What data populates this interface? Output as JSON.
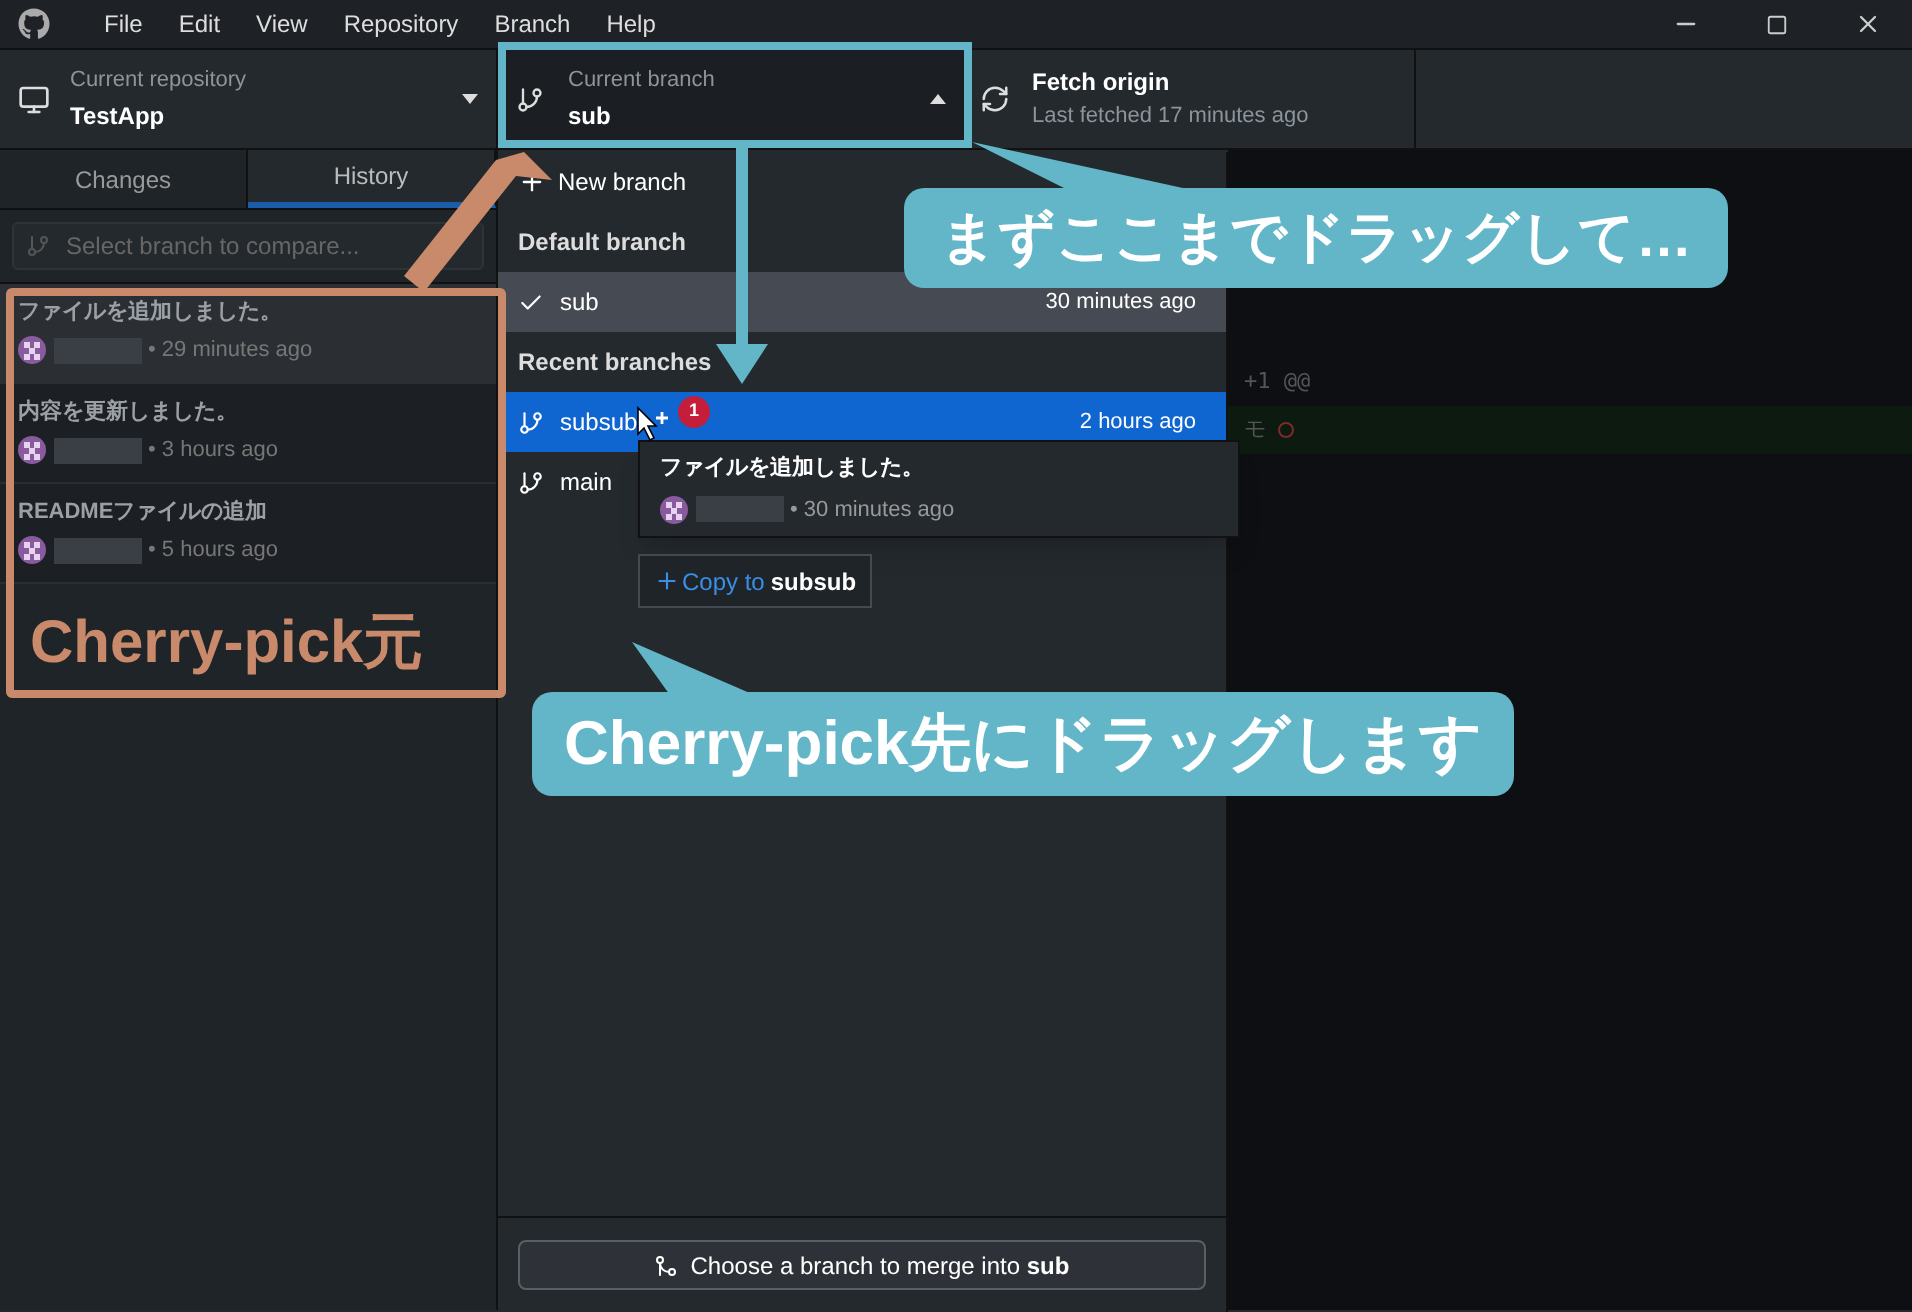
{
  "menu": [
    "File",
    "Edit",
    "View",
    "Repository",
    "Branch",
    "Help"
  ],
  "toolbar": {
    "repository": {
      "label": "Current repository",
      "value": "TestApp"
    },
    "branch": {
      "label": "Current branch",
      "value": "sub",
      "expanded": true
    },
    "fetch": {
      "label": "Fetch origin",
      "detail": "Last fetched 17 minutes ago"
    }
  },
  "sidebar": {
    "tabs": [
      {
        "label": "Changes",
        "selected": false
      },
      {
        "label": "History",
        "selected": true
      }
    ],
    "compare": {
      "placeholder": "Select branch to compare..."
    },
    "commits": [
      {
        "title": "ファイルを追加しました。",
        "time": "• 29 minutes ago",
        "selected": true
      },
      {
        "title": "内容を更新しました。",
        "time": "• 3 hours ago",
        "selected": false
      },
      {
        "title": "READMEファイルの追加",
        "time": "• 5 hours ago",
        "selected": false
      }
    ]
  },
  "branch_menu": {
    "new_branch": "New branch",
    "sections": [
      {
        "heading": "Default branch",
        "items": [
          {
            "name": "sub",
            "time": "30 minutes ago",
            "current": true,
            "selected": false
          }
        ]
      },
      {
        "heading": "Recent branches",
        "items": [
          {
            "name": "subsub",
            "time": "2 hours ago",
            "current": false,
            "selected": true
          },
          {
            "name": "main",
            "current": false,
            "selected": false
          }
        ]
      }
    ],
    "merge_button": "Choose a branch to merge into **sub**"
  },
  "drag": {
    "badge": "1",
    "title": "ファイルを追加しました。",
    "time": "• 30 minutes ago",
    "copy_label": "Copy to",
    "copy_target": "subsub"
  },
  "diff": {
    "lines": [
      {
        "text": "+1 @@",
        "kind": "hunk"
      },
      {
        "text": "モ",
        "kind": "added"
      }
    ]
  },
  "annotations": [
    {
      "text": "まずここまでドラッグして…",
      "color": "#62b6c7"
    },
    {
      "text": "Cherry-pick先にドラッグします",
      "color": "#62b6c7"
    },
    {
      "text": "Cherry-pick元",
      "color": "#c98a6b"
    }
  ]
}
